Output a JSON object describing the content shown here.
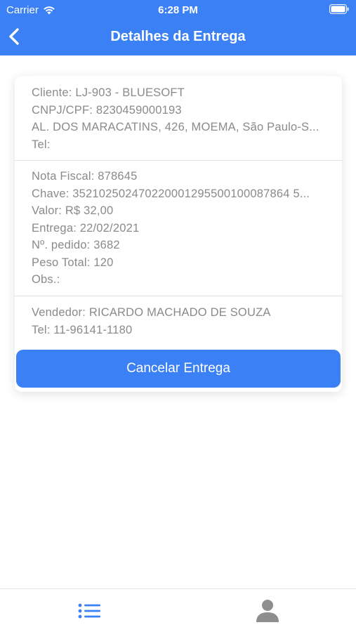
{
  "status_bar": {
    "carrier": "Carrier",
    "time": "6:28 PM"
  },
  "nav": {
    "title": "Detalhes da Entrega",
    "back_icon": "chevron-left-icon"
  },
  "customer": {
    "cliente": "Cliente: LJ-903 - BLUESOFT",
    "cnpj": "CNPJ/CPF: 8230459000193",
    "endereco": "AL. DOS MARACATINS, 426, MOEMA, São Paulo-S...",
    "tel": "Tel:"
  },
  "invoice": {
    "nota_fiscal": "Nota Fiscal: 878645",
    "chave": "Chave: 352102502470220001295500100087864 5...",
    "valor": "Valor: R$ 32,00",
    "entrega": "Entrega: 22/02/2021",
    "pedido": "Nº. pedido: 3682",
    "peso": "Peso Total: 120",
    "obs": "Obs.:"
  },
  "seller": {
    "vendedor": "Vendedor: RICARDO MACHADO DE SOUZA",
    "tel": "Tel: 11-96141-1180"
  },
  "actions": {
    "cancel_label": "Cancelar Entrega"
  },
  "tabbar": {
    "tabs": [
      {
        "icon": "list-icon",
        "active": true
      },
      {
        "icon": "user-icon",
        "active": false
      }
    ]
  },
  "colors": {
    "primary": "#3b80f4",
    "text_muted": "#8a8a8a",
    "tab_inactive": "#8e8e8e"
  }
}
